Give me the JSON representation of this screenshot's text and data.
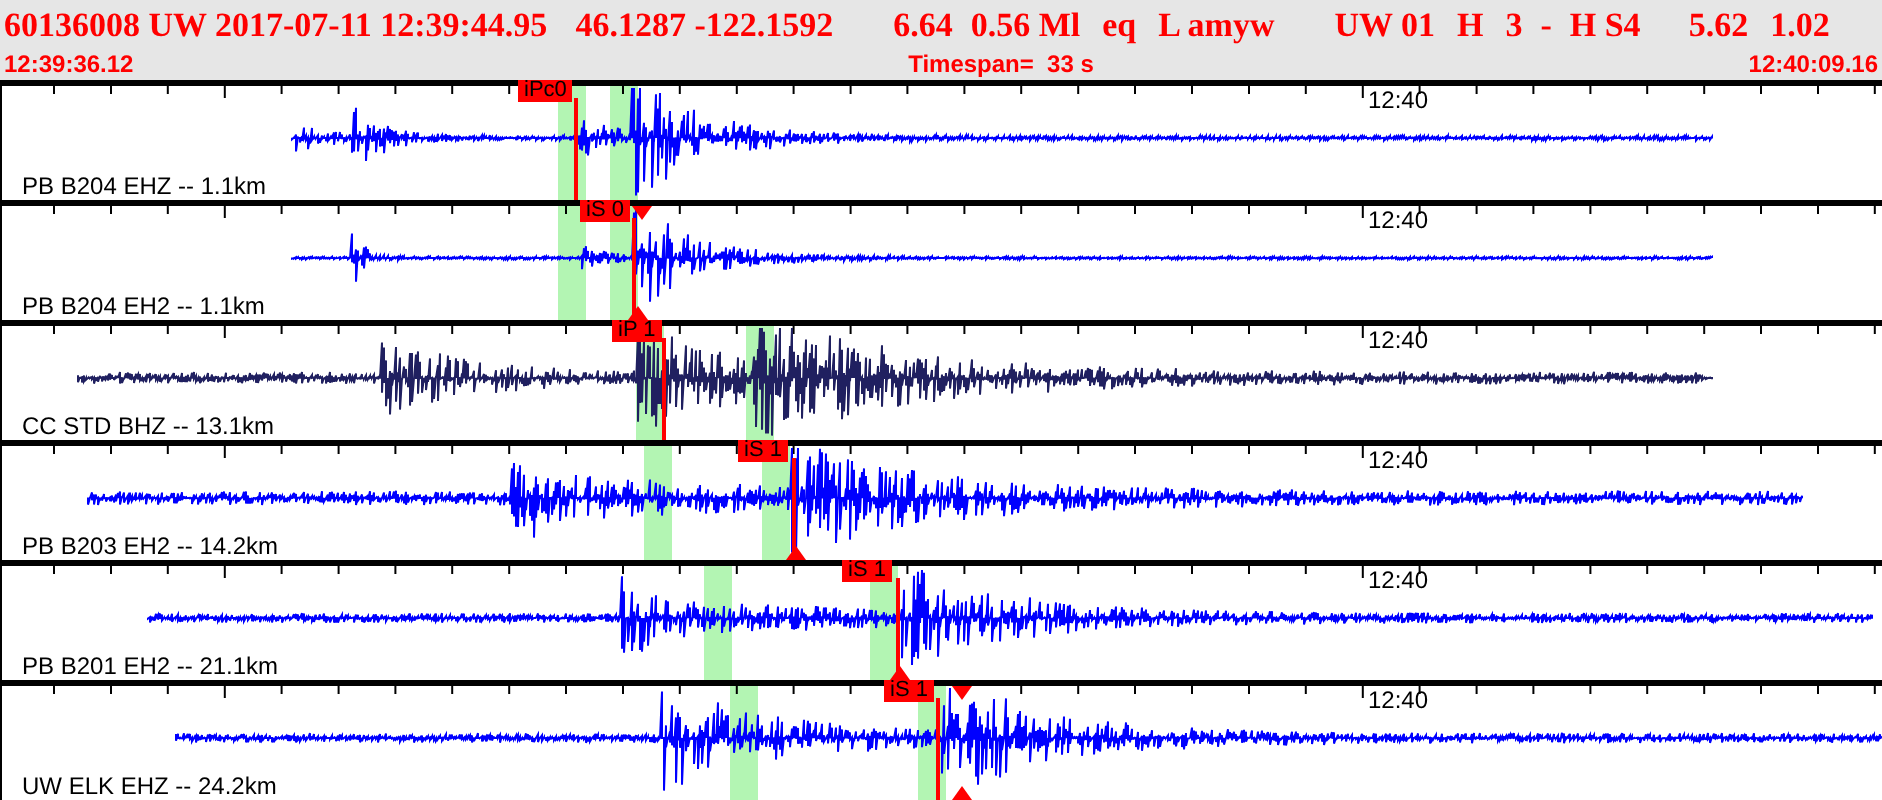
{
  "header": {
    "fields": [
      "60136008 UW 2017-07-11 12:39:44.95",
      "46.1287 -122.1592",
      "6.64",
      "0.56 Ml",
      "eq",
      "L amyw",
      "UW 01",
      "H",
      "3",
      "-",
      "H S4",
      "5.62",
      "1.02"
    ],
    "start_time": "12:39:36.12",
    "timespan": "Timespan=  33 s",
    "end_time": "12:40:09.16"
  },
  "channels": [
    {
      "label": "PB B204 EHZ -- 1.1km",
      "time_mark": "12:40",
      "pick": "iPc0",
      "color": "#0000ff"
    },
    {
      "label": "PB B204 EH2 -- 1.1km",
      "time_mark": "12:40",
      "pick": "iS 0",
      "color": "#0000ff"
    },
    {
      "label": "CC STD BHZ -- 13.1km",
      "time_mark": "12:40",
      "pick": "iP 1",
      "color": "#202060"
    },
    {
      "label": "PB B203 EH2 -- 14.2km",
      "time_mark": "12:40",
      "pick": "iS 1",
      "color": "#0000ff"
    },
    {
      "label": "PB B201 EH2 -- 21.1km",
      "time_mark": "12:40",
      "pick": "iS 1",
      "color": "#0000ff"
    },
    {
      "label": "UW ELK EHZ -- 24.2km",
      "time_mark": "12:40",
      "pick": "iS 1",
      "color": "#0000ff"
    }
  ]
}
